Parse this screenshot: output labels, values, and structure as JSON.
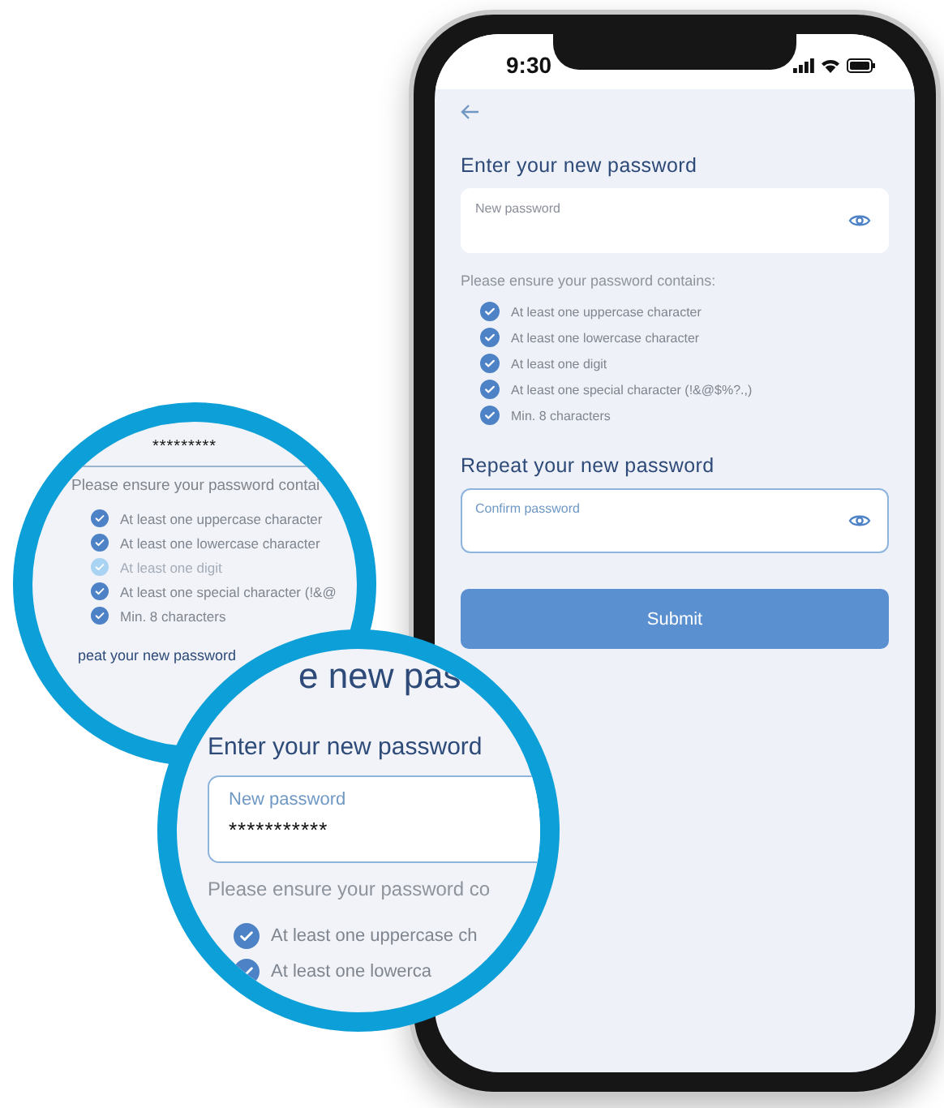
{
  "phone": {
    "status_bar": {
      "time": "9:30"
    },
    "heading_1": "Enter your new password",
    "password_field": {
      "placeholder": "New password",
      "focused": false
    },
    "hint": "Please ensure your password contains:",
    "requirements": [
      {
        "text": "At least one uppercase character",
        "checked": true
      },
      {
        "text": "At least one lowercase character",
        "checked": true
      },
      {
        "text": "At least one digit",
        "checked": true
      },
      {
        "text": "At least one special character (!&@$%?.,)",
        "checked": true
      },
      {
        "text": "Min. 8 characters",
        "checked": true
      }
    ],
    "heading_2": "Repeat your new password",
    "confirm_field": {
      "placeholder": "Confirm password",
      "focused": true
    },
    "submit": "Submit"
  },
  "magnifier_top": {
    "masked_value": "*********",
    "hint": "Please ensure your password contai",
    "requirements": [
      {
        "text": "At least one uppercase character",
        "checked": true
      },
      {
        "text": "At least one lowercase character",
        "checked": true
      },
      {
        "text": "At least one digit",
        "checked": false
      },
      {
        "text": "At least one special character (!&@",
        "checked": true
      },
      {
        "text": "Min. 8 characters",
        "checked": true
      }
    ],
    "heading": "peat your new password"
  },
  "magnifier_bottom": {
    "fragment": "e new pas",
    "heading": "Enter your new password",
    "field": {
      "label": "New password",
      "value": "***********"
    },
    "hint": "Please ensure your password co",
    "requirements": [
      {
        "text": "At least one uppercase ch",
        "checked": true
      },
      {
        "text": "At least one lowerca",
        "checked": true
      }
    ]
  }
}
